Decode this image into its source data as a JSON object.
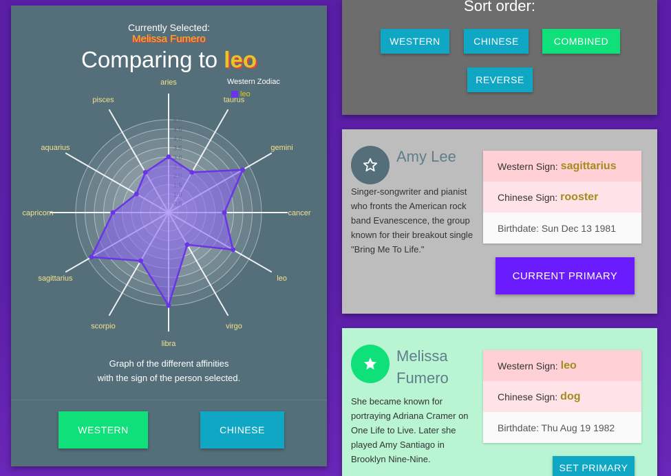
{
  "left_panel": {
    "current_label": "Currently Selected:",
    "current_name": "Melissa Fumero",
    "comparing_prefix": "Comparing to",
    "comparing_sign": "leo",
    "caption_line1": "Graph of the different affinities",
    "caption_line2": "with the sign of the person selected.",
    "btn_western": "WESTERN",
    "btn_chinese": "CHINESE"
  },
  "chart_data": {
    "type": "radar",
    "legend_title": "Western Zodiac",
    "series": [
      {
        "name": "leo",
        "values": [
          3.0,
          2.5,
          4.6,
          3.0,
          4.0,
          2.0,
          5.0,
          3.0,
          4.8,
          3.0,
          2.0,
          2.5
        ]
      }
    ],
    "categories": [
      "aries",
      "taurus",
      "gemini",
      "cancer",
      "leo",
      "virgo",
      "libra",
      "scorpio",
      "sagittarius",
      "capricorn",
      "aquarius",
      "pisces"
    ],
    "r_ticks": [
      "0.5",
      "1.0",
      "1.5",
      "2.0",
      "2.5",
      "3.0",
      "3.5",
      "4.0",
      "4.5",
      "5.0"
    ],
    "r_range": [
      0,
      5
    ],
    "colors": {
      "series": "#6a34e8",
      "fill": "rgba(130,90,240,0.55)",
      "labels": "#f3e28a"
    }
  },
  "sort_panel": {
    "title": "Sort order:",
    "btn_western": "WESTERN",
    "btn_chinese": "CHINESE",
    "btn_combined": "COMBINED",
    "btn_reverse": "REVERSE"
  },
  "cards": [
    {
      "name": "Amy Lee",
      "description": "Singer-songwriter and pianist who fronts the American rock band Evanescence, the group known for their breakout single \"Bring Me To Life.\"",
      "western_label": "Western Sign:",
      "western_value": "sagittarius",
      "chinese_label": "Chinese Sign:",
      "chinese_value": "rooster",
      "birthdate": "Birthdate: Sun Dec 13 1981",
      "button": "CURRENT PRIMARY",
      "icon": "star-outline-icon"
    },
    {
      "name_line1": "Melissa",
      "name_line2": "Fumero",
      "description": "She became known for portraying Adriana Cramer on One Life to Live. Later she played Amy Santiago in Brooklyn Nine-Nine.",
      "western_label": "Western Sign:",
      "western_value": "leo",
      "chinese_label": "Chinese Sign:",
      "chinese_value": "dog",
      "birthdate": "Birthdate: Thu Aug 19 1982",
      "button": "SET PRIMARY",
      "icon": "star-filled-icon"
    }
  ]
}
